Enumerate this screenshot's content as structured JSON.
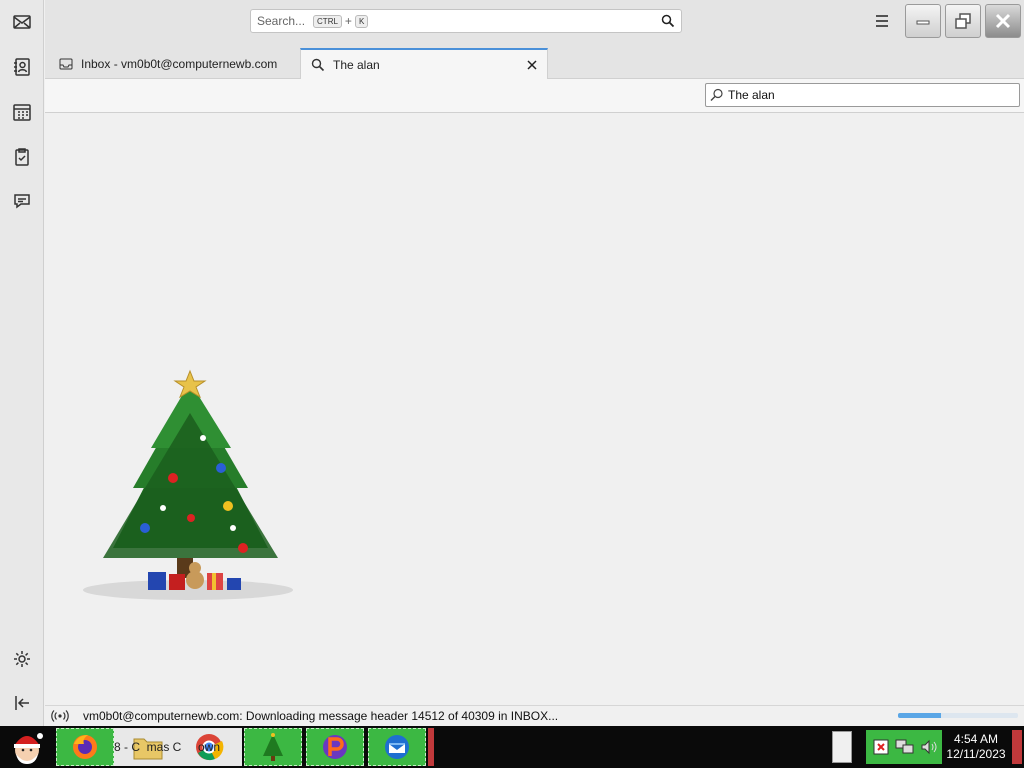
{
  "spaces": {
    "items": [
      "mail-icon",
      "address-book-icon",
      "calendar-icon",
      "tasks-icon",
      "chat-icon"
    ],
    "bottom": [
      "settings-icon",
      "collapse-icon"
    ]
  },
  "titlebar": {
    "search_placeholder": "Search...",
    "shortcut_key1": "CTRL",
    "shortcut_plus": "+",
    "shortcut_key2": "K"
  },
  "tabs": [
    {
      "label": "Inbox - vm0b0t@computernewb.com",
      "icon": "inbox-icon",
      "active": false
    },
    {
      "label": "The alan",
      "icon": "search-icon",
      "active": true
    }
  ],
  "quick_filter": {
    "value": "The alan"
  },
  "status": {
    "text": "vm0b0t@computernewb.com: Downloading message header 14512 of 40309 in INBOX...",
    "progress": 0.36
  },
  "taskbar": {
    "label_fragment": "8 - C  mas C     own",
    "time": "4:54 AM",
    "date": "12/11/2023"
  },
  "colors": {
    "accent": "#4a90d9",
    "taskbar_green": "#3cb843",
    "taskbar_bg": "#0a0a0a"
  }
}
